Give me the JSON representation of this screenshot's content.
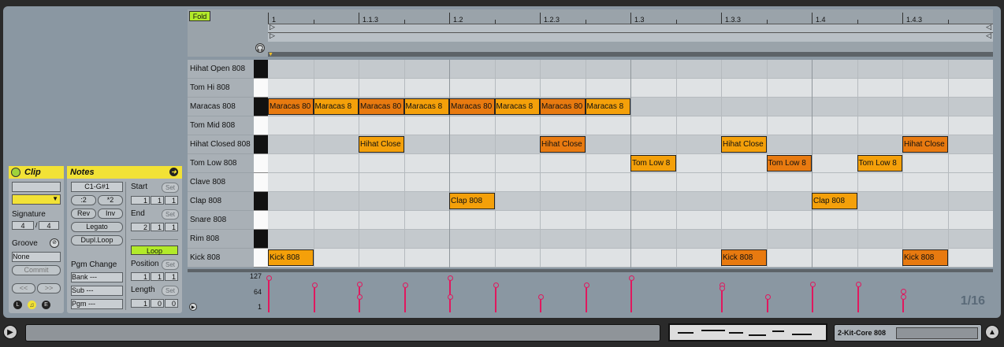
{
  "clip": {
    "header": "Clip",
    "signature_label": "Signature",
    "sig_num": "4",
    "sig_den": "4",
    "groove_label": "Groove",
    "groove_value": "None",
    "commit": "Commit",
    "prev": "<<",
    "next": ">>",
    "l": "L",
    "e": "E"
  },
  "notes": {
    "header": "Notes",
    "range": "C1-G#1",
    "half": ":2",
    "double": "*2",
    "rev": "Rev",
    "inv": "Inv",
    "legato": "Legato",
    "dupl": "Dupl.Loop",
    "pgm_label": "Pgm Change",
    "bank": "Bank ---",
    "sub": "Sub ---",
    "pgm": "Pgm ---",
    "start_label": "Start",
    "end_label": "End",
    "loop": "Loop",
    "position_label": "Position",
    "length_label": "Length",
    "set": "Set",
    "start": [
      "1",
      "1",
      "1"
    ],
    "end": [
      "2",
      "1",
      "1"
    ],
    "position": [
      "1",
      "1",
      "1"
    ],
    "length": [
      "1",
      "0",
      "0"
    ]
  },
  "editor": {
    "fold": "Fold",
    "ruler": [
      "1",
      "1.1.3",
      "1.2",
      "1.2.3",
      "1.3",
      "1.3.3",
      "1.4",
      "1.4.3"
    ],
    "keys": [
      "Hihat Open 808",
      "Tom Hi 808",
      "Maracas 808",
      "Tom Mid 808",
      "Hihat Closed 808",
      "Tom Low 808",
      "Clave 808",
      "Clap 808",
      "Snare 808",
      "Rim 808",
      "Kick 808"
    ],
    "vel_max": "127",
    "vel_mid": "64",
    "vel_min": "1",
    "grid": "1/16"
  },
  "note_events": [
    {
      "row": 2,
      "step": 0,
      "label": "Maracas 80",
      "color": "#e87a10"
    },
    {
      "row": 2,
      "step": 1,
      "label": "Maracas 8",
      "color": "#f4a00a"
    },
    {
      "row": 2,
      "step": 2,
      "label": "Maracas 80",
      "color": "#e87a10"
    },
    {
      "row": 2,
      "step": 3,
      "label": "Maracas 8",
      "color": "#f4a00a"
    },
    {
      "row": 2,
      "step": 4,
      "label": "Maracas 80",
      "color": "#e87a10"
    },
    {
      "row": 2,
      "step": 5,
      "label": "Maracas 8",
      "color": "#f4a00a"
    },
    {
      "row": 2,
      "step": 6,
      "label": "Maracas 80",
      "color": "#e87a10"
    },
    {
      "row": 2,
      "step": 7,
      "label": "Maracas 8",
      "color": "#f4a00a"
    },
    {
      "row": 4,
      "step": 2,
      "label": "Hihat Close",
      "color": "#f4a00a"
    },
    {
      "row": 4,
      "step": 6,
      "label": "Hihat Close",
      "color": "#e87a10"
    },
    {
      "row": 4,
      "step": 10,
      "label": "Hihat Close",
      "color": "#f4a00a"
    },
    {
      "row": 4,
      "step": 14,
      "label": "Hihat Close",
      "color": "#e87a10"
    },
    {
      "row": 5,
      "step": 8,
      "label": "Tom Low 8",
      "color": "#f4a00a"
    },
    {
      "row": 5,
      "step": 11,
      "label": "Tom Low 8",
      "color": "#e87a10"
    },
    {
      "row": 5,
      "step": 13,
      "label": "Tom Low 8",
      "color": "#f4a00a"
    },
    {
      "row": 7,
      "step": 4,
      "label": "Clap 808",
      "color": "#f4a00a"
    },
    {
      "row": 7,
      "step": 12,
      "label": "Clap 808",
      "color": "#f4a00a"
    },
    {
      "row": 10,
      "step": 0,
      "label": "Kick 808",
      "color": "#f4a00a"
    },
    {
      "row": 10,
      "step": 10,
      "label": "Kick 808",
      "color": "#e87a10"
    },
    {
      "row": 10,
      "step": 14,
      "label": "Kick 808",
      "color": "#e87a10"
    }
  ],
  "velocities": [
    {
      "step": 0,
      "values": [
        100
      ]
    },
    {
      "step": 1,
      "values": [
        80
      ]
    },
    {
      "step": 2,
      "values": [
        82,
        45
      ]
    },
    {
      "step": 3,
      "values": [
        80
      ]
    },
    {
      "step": 4,
      "values": [
        100,
        45
      ]
    },
    {
      "step": 5,
      "values": [
        80
      ]
    },
    {
      "step": 6,
      "values": [
        45
      ]
    },
    {
      "step": 7,
      "values": [
        80
      ]
    },
    {
      "step": 8,
      "values": [
        100
      ]
    },
    {
      "step": 10,
      "values": [
        80,
        70
      ]
    },
    {
      "step": 11,
      "values": [
        45
      ]
    },
    {
      "step": 12,
      "values": [
        82
      ]
    },
    {
      "step": 13,
      "values": [
        82
      ]
    },
    {
      "step": 14,
      "values": [
        62,
        45
      ]
    }
  ],
  "statusbar": {
    "track": "2-Kit-Core 808"
  }
}
